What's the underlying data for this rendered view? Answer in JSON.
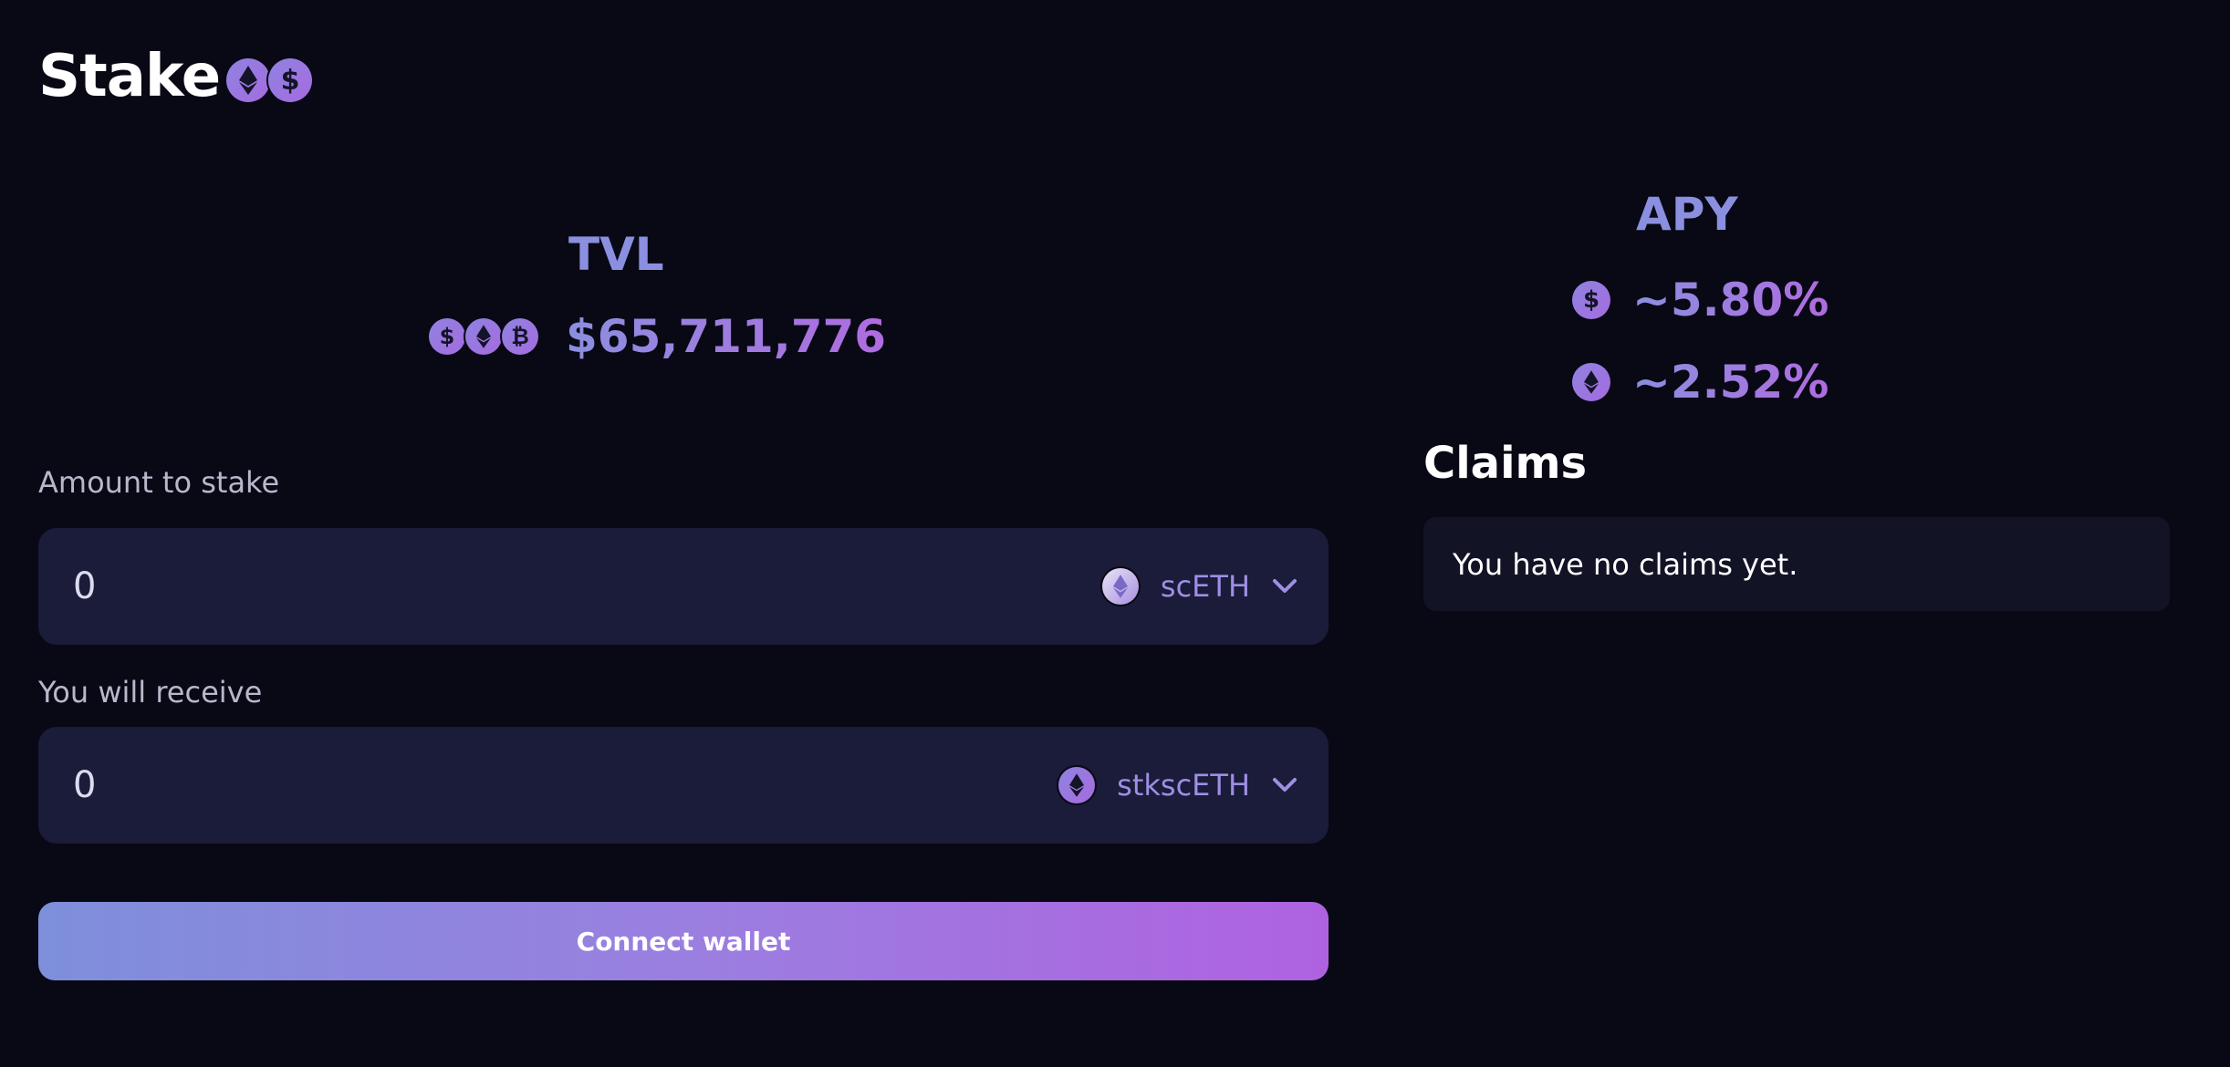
{
  "page": {
    "title": "Stake"
  },
  "title_icons": [
    "eth-coin-icon",
    "dollar-coin-icon"
  ],
  "tvl": {
    "label": "TVL",
    "value": "$65,711,776",
    "icons": [
      "dollar-coin-icon",
      "eth-coin-icon",
      "bitcoin-coin-icon"
    ],
    "icon_glyphs": {
      "dollar": "$",
      "bitcoin": "₿"
    }
  },
  "apy": {
    "label": "APY",
    "rows": [
      {
        "icon": "dollar-coin-icon",
        "glyph": "$",
        "value": "~5.80%"
      },
      {
        "icon": "eth-coin-icon",
        "value": "~2.52%"
      }
    ]
  },
  "stake_form": {
    "amount_label": "Amount to stake",
    "amount_value": "0",
    "amount_token": "scETH",
    "receive_label": "You will receive",
    "receive_value": "0",
    "receive_token": "stkscETH",
    "connect_label": "Connect wallet"
  },
  "claims": {
    "title": "Claims",
    "empty_message": "You have no claims yet."
  },
  "colors": {
    "background": "#090915",
    "input_bg": "#1b1b3a",
    "accent_start": "#7e8fdb",
    "accent_end": "#af62e0",
    "label_accent": "#8b8fe0"
  }
}
